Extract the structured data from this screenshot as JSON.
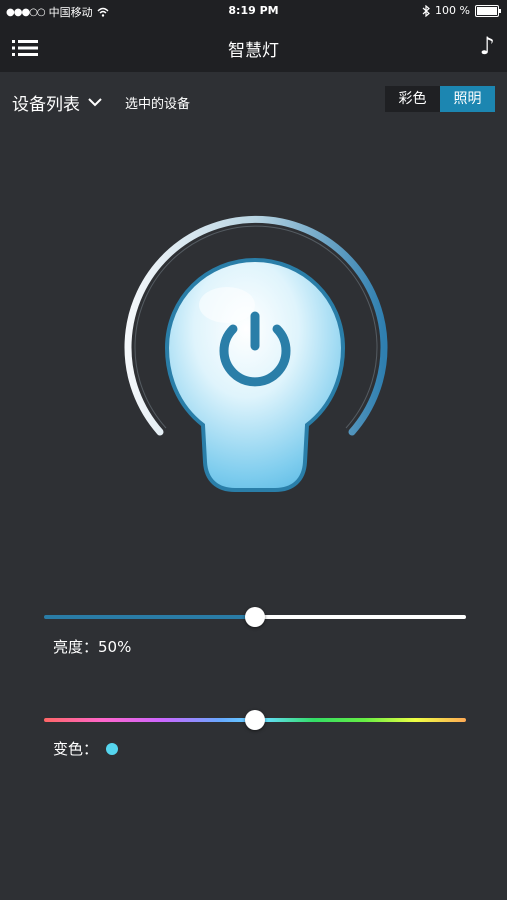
{
  "status_bar": {
    "signal": "●●●○○",
    "carrier": "中国移动",
    "time": "8:19 PM",
    "battery": "100 %"
  },
  "nav": {
    "title": "智慧灯",
    "music_glyph": "♪"
  },
  "device_row": {
    "device_list_label": "设备列表",
    "selected_device": "选中的设备",
    "mode_options": [
      {
        "label": "彩色",
        "selected": false
      },
      {
        "label": "照明",
        "selected": true
      }
    ]
  },
  "brightness": {
    "label": "亮度：50%",
    "value_percent": 50
  },
  "color": {
    "label": "变色：",
    "value_fraction": 0.5,
    "current_color": "#55d5ee"
  },
  "colors": {
    "accent": "#1c86b1",
    "background": "#2e3034",
    "bar": "#1f2023"
  }
}
